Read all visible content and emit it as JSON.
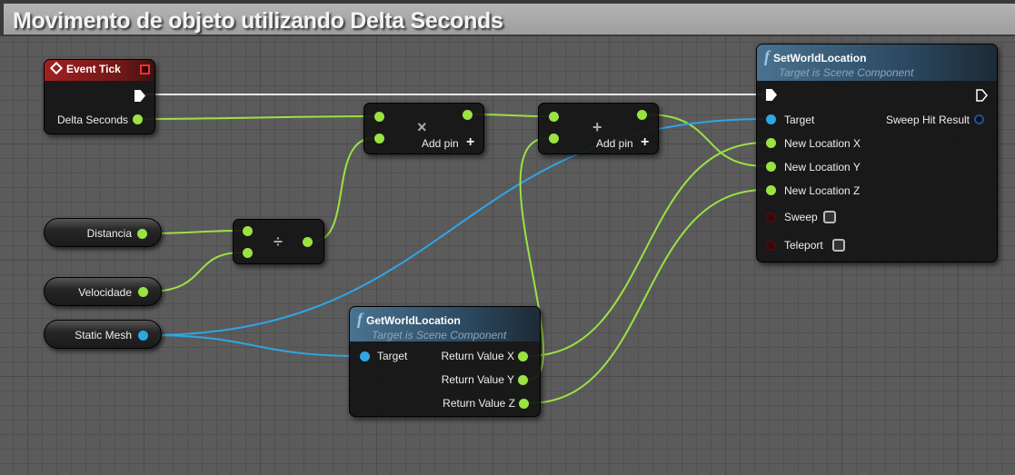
{
  "title": "Movimento de objeto utilizando Delta Seconds",
  "colors": {
    "float_pin": "#9be243",
    "object_pin": "#2ea6e6",
    "bool_pin": "#5a1010",
    "event_header": "#a02020",
    "function_header": "#4a7290"
  },
  "event_tick": {
    "title": "Event Tick",
    "icon": "event-diamond-icon",
    "outputs": [
      "Delta Seconds"
    ]
  },
  "multiply": {
    "symbol": "×",
    "add_pin": "Add pin"
  },
  "add": {
    "symbol": "+",
    "add_pin": "Add pin"
  },
  "divide": {
    "symbol": "÷"
  },
  "variables": [
    "Distancia",
    "Velocidade",
    "Static Mesh"
  ],
  "get_world_location": {
    "title": "GetWorldLocation",
    "subtitle": "Target is Scene Component",
    "icon": "function-icon",
    "inputs": [
      "Target"
    ],
    "outputs": [
      "Return Value X",
      "Return Value Y",
      "Return Value Z"
    ]
  },
  "set_world_location": {
    "title": "SetWorldLocation",
    "subtitle": "Target is Scene Component",
    "icon": "function-icon",
    "inputs": [
      "Target",
      "New Location X",
      "New Location Y",
      "New Location Z",
      "Sweep",
      "Teleport"
    ],
    "outputs": [
      "Sweep Hit Result"
    ],
    "sweep_checked": false,
    "teleport_checked": false
  }
}
